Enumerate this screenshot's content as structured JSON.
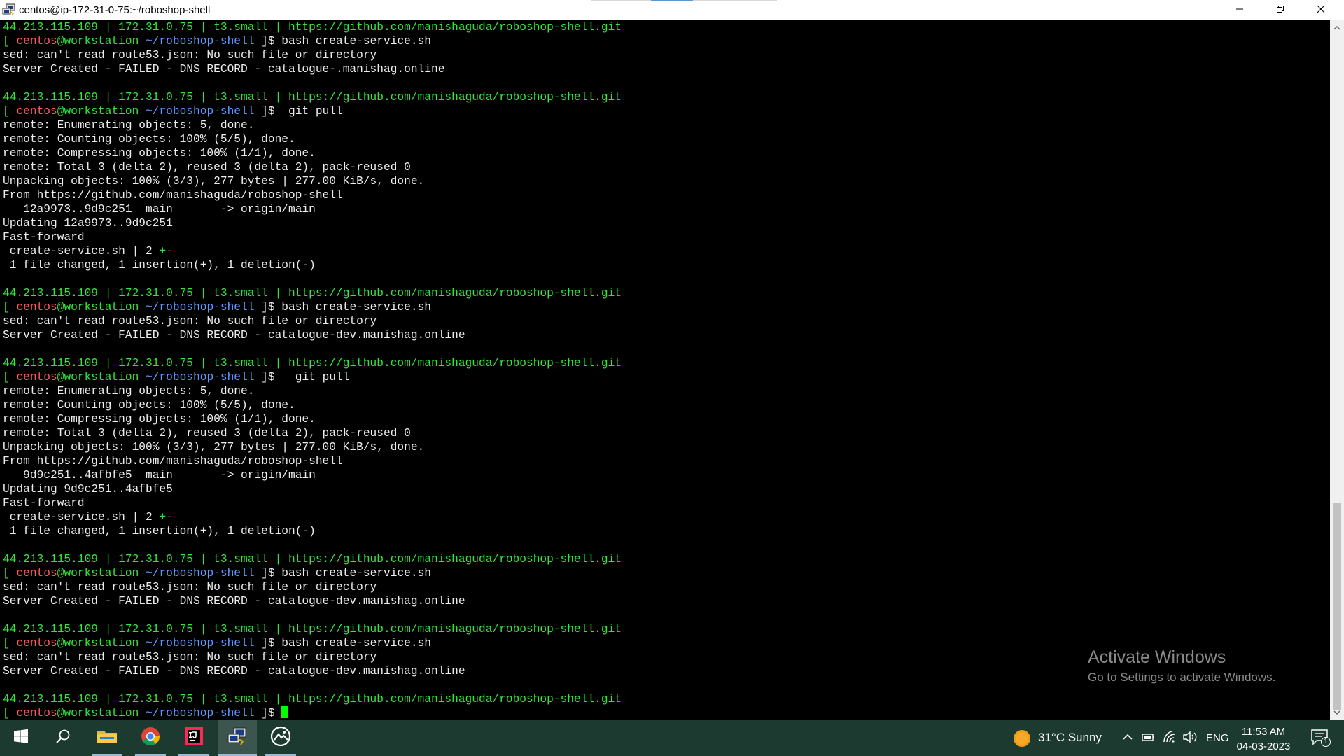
{
  "window": {
    "title": "centos@ip-172-31-0-75:~/roboshop-shell"
  },
  "terminal": {
    "lines": [
      [
        {
          "t": "44.213.115.109 | 172.31.0.75 | t3.small | https://github.com/manishaguda/roboshop-shell.git",
          "c": "g"
        }
      ],
      [
        {
          "t": "[ ",
          "c": "g"
        },
        {
          "t": "centos",
          "c": "r"
        },
        {
          "t": "@workstation",
          "c": "g"
        },
        {
          "t": " ~/roboshop-shell",
          "c": "b"
        },
        {
          "t": " ]$ bash create-service.sh",
          "c": ""
        }
      ],
      [
        {
          "t": "sed: can't read route53.json: No such file or directory",
          "c": ""
        }
      ],
      [
        {
          "t": "Server Created - FAILED - DNS RECORD - catalogue-.manishag.online",
          "c": ""
        }
      ],
      [],
      [
        {
          "t": "44.213.115.109 | 172.31.0.75 | t3.small | https://github.com/manishaguda/roboshop-shell.git",
          "c": "g"
        }
      ],
      [
        {
          "t": "[ ",
          "c": "g"
        },
        {
          "t": "centos",
          "c": "r"
        },
        {
          "t": "@workstation",
          "c": "g"
        },
        {
          "t": " ~/roboshop-shell",
          "c": "b"
        },
        {
          "t": " ]$  git pull",
          "c": ""
        }
      ],
      [
        {
          "t": "remote: Enumerating objects: 5, done.",
          "c": ""
        }
      ],
      [
        {
          "t": "remote: Counting objects: 100% (5/5), done.",
          "c": ""
        }
      ],
      [
        {
          "t": "remote: Compressing objects: 100% (1/1), done.",
          "c": ""
        }
      ],
      [
        {
          "t": "remote: Total 3 (delta 2), reused 3 (delta 2), pack-reused 0",
          "c": ""
        }
      ],
      [
        {
          "t": "Unpacking objects: 100% (3/3), 277 bytes | 277.00 KiB/s, done.",
          "c": ""
        }
      ],
      [
        {
          "t": "From https://github.com/manishaguda/roboshop-shell",
          "c": ""
        }
      ],
      [
        {
          "t": "   12a9973..9d9c251  main       -> origin/main",
          "c": ""
        }
      ],
      [
        {
          "t": "Updating 12a9973..9d9c251",
          "c": ""
        }
      ],
      [
        {
          "t": "Fast-forward",
          "c": ""
        }
      ],
      [
        {
          "t": " create-service.sh | 2 ",
          "c": ""
        },
        {
          "t": "+",
          "c": "g"
        },
        {
          "t": "-",
          "c": "r"
        }
      ],
      [
        {
          "t": " 1 file changed, 1 insertion(+), 1 deletion(-)",
          "c": ""
        }
      ],
      [],
      [
        {
          "t": "44.213.115.109 | 172.31.0.75 | t3.small | https://github.com/manishaguda/roboshop-shell.git",
          "c": "g"
        }
      ],
      [
        {
          "t": "[ ",
          "c": "g"
        },
        {
          "t": "centos",
          "c": "r"
        },
        {
          "t": "@workstation",
          "c": "g"
        },
        {
          "t": " ~/roboshop-shell",
          "c": "b"
        },
        {
          "t": " ]$ bash create-service.sh",
          "c": ""
        }
      ],
      [
        {
          "t": "sed: can't read route53.json: No such file or directory",
          "c": ""
        }
      ],
      [
        {
          "t": "Server Created - FAILED - DNS RECORD - catalogue-dev.manishag.online",
          "c": ""
        }
      ],
      [],
      [
        {
          "t": "44.213.115.109 | 172.31.0.75 | t3.small | https://github.com/manishaguda/roboshop-shell.git",
          "c": "g"
        }
      ],
      [
        {
          "t": "[ ",
          "c": "g"
        },
        {
          "t": "centos",
          "c": "r"
        },
        {
          "t": "@workstation",
          "c": "g"
        },
        {
          "t": " ~/roboshop-shell",
          "c": "b"
        },
        {
          "t": " ]$   git pull",
          "c": ""
        }
      ],
      [
        {
          "t": "remote: Enumerating objects: 5, done.",
          "c": ""
        }
      ],
      [
        {
          "t": "remote: Counting objects: 100% (5/5), done.",
          "c": ""
        }
      ],
      [
        {
          "t": "remote: Compressing objects: 100% (1/1), done.",
          "c": ""
        }
      ],
      [
        {
          "t": "remote: Total 3 (delta 2), reused 3 (delta 2), pack-reused 0",
          "c": ""
        }
      ],
      [
        {
          "t": "Unpacking objects: 100% (3/3), 277 bytes | 277.00 KiB/s, done.",
          "c": ""
        }
      ],
      [
        {
          "t": "From https://github.com/manishaguda/roboshop-shell",
          "c": ""
        }
      ],
      [
        {
          "t": "   9d9c251..4afbfe5  main       -> origin/main",
          "c": ""
        }
      ],
      [
        {
          "t": "Updating 9d9c251..4afbfe5",
          "c": ""
        }
      ],
      [
        {
          "t": "Fast-forward",
          "c": ""
        }
      ],
      [
        {
          "t": " create-service.sh | 2 ",
          "c": ""
        },
        {
          "t": "+",
          "c": "g"
        },
        {
          "t": "-",
          "c": "r"
        }
      ],
      [
        {
          "t": " 1 file changed, 1 insertion(+), 1 deletion(-)",
          "c": ""
        }
      ],
      [],
      [
        {
          "t": "44.213.115.109 | 172.31.0.75 | t3.small | https://github.com/manishaguda/roboshop-shell.git",
          "c": "g"
        }
      ],
      [
        {
          "t": "[ ",
          "c": "g"
        },
        {
          "t": "centos",
          "c": "r"
        },
        {
          "t": "@workstation",
          "c": "g"
        },
        {
          "t": " ~/roboshop-shell",
          "c": "b"
        },
        {
          "t": " ]$ bash create-service.sh",
          "c": ""
        }
      ],
      [
        {
          "t": "sed: can't read route53.json: No such file or directory",
          "c": ""
        }
      ],
      [
        {
          "t": "Server Created - FAILED - DNS RECORD - catalogue-dev.manishag.online",
          "c": ""
        }
      ],
      [],
      [
        {
          "t": "44.213.115.109 | 172.31.0.75 | t3.small | https://github.com/manishaguda/roboshop-shell.git",
          "c": "g"
        }
      ],
      [
        {
          "t": "[ ",
          "c": "g"
        },
        {
          "t": "centos",
          "c": "r"
        },
        {
          "t": "@workstation",
          "c": "g"
        },
        {
          "t": " ~/roboshop-shell",
          "c": "b"
        },
        {
          "t": " ]$ bash create-service.sh",
          "c": ""
        }
      ],
      [
        {
          "t": "sed: can't read route53.json: No such file or directory",
          "c": ""
        }
      ],
      [
        {
          "t": "Server Created - FAILED - DNS RECORD - catalogue-dev.manishag.online",
          "c": ""
        }
      ],
      [],
      [
        {
          "t": "44.213.115.109 | 172.31.0.75 | t3.small | https://github.com/manishaguda/roboshop-shell.git",
          "c": "g"
        }
      ],
      [
        {
          "t": "[ ",
          "c": "g"
        },
        {
          "t": "centos",
          "c": "r"
        },
        {
          "t": "@workstation",
          "c": "g"
        },
        {
          "t": " ~/roboshop-shell",
          "c": "b"
        },
        {
          "t": " ]$ ",
          "c": ""
        }
      ]
    ]
  },
  "watermark": {
    "line1": "Activate Windows",
    "line2": "Go to Settings to activate Windows."
  },
  "taskbar": {
    "weather": "31°C  Sunny",
    "language": "ENG",
    "time": "11:53 AM",
    "date": "04-03-2023",
    "notification_count": "1"
  },
  "colors": {
    "terminal_green": "#33e53a",
    "prompt_user_red": "#ff5c5c",
    "prompt_path_blue": "#5f9bff",
    "cursor": "#00ff00",
    "taskbar_bg": "#1d3a31"
  },
  "icons": [
    "putty-icon",
    "minimize-icon",
    "restore-icon",
    "close-icon",
    "scroll-up-icon",
    "scroll-down-icon",
    "windows-start-icon",
    "search-icon",
    "file-explorer-icon",
    "chrome-icon",
    "intellij-icon",
    "putty-taskbar-icon",
    "media-app-icon",
    "weather-sun-icon",
    "chevron-up-icon",
    "battery-icon",
    "wifi-icon",
    "volume-icon",
    "notification-icon"
  ]
}
